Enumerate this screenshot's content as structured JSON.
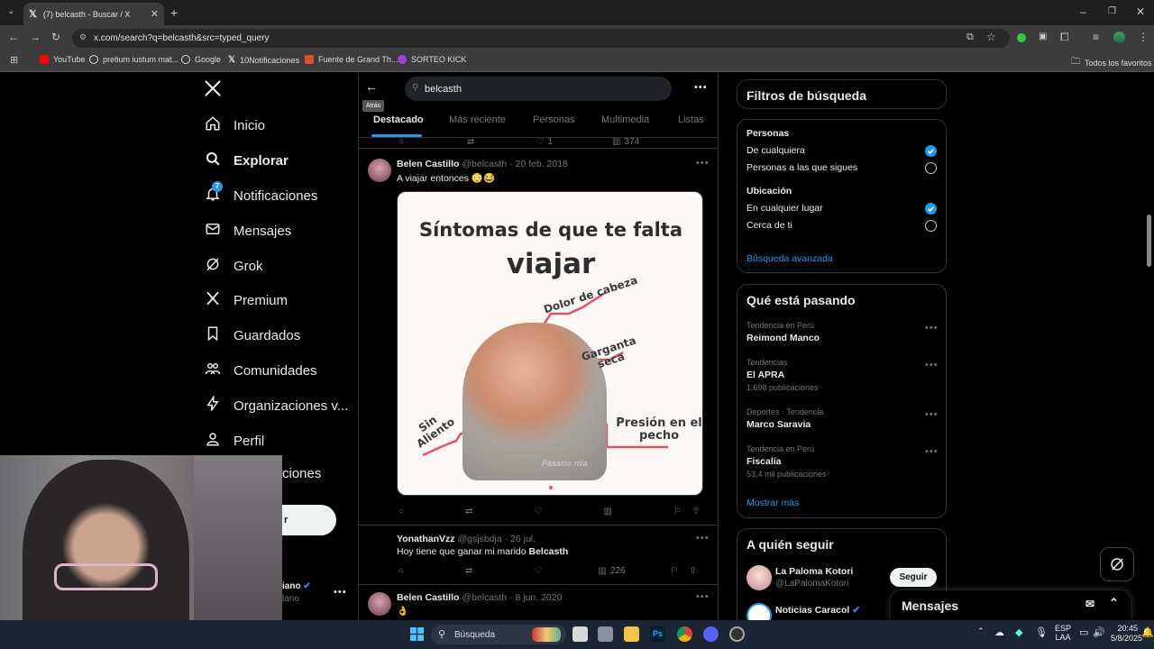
{
  "browser": {
    "tab_title": "(7) belcasth - Buscar / X",
    "url": "x.com/search?q=belcasth&src=typed_query",
    "bookmarks": [
      {
        "label": "YouTube",
        "color": "#ff0000"
      },
      {
        "label": "pretium iustum mat...",
        "color": "#dddddd"
      },
      {
        "label": "Google",
        "color": "#dddddd"
      },
      {
        "label": "10Notificaciones",
        "color": "#ffffff"
      },
      {
        "label": "Fuente de Grand Th...",
        "color": "#e34b2d"
      },
      {
        "label": "SORTEO KICK",
        "color": "#a03fd6"
      }
    ],
    "all_bookmarks": "Todos los favoritos"
  },
  "nav": {
    "items": [
      {
        "label": "Inicio",
        "icon": "home-icon"
      },
      {
        "label": "Explorar",
        "icon": "search-icon",
        "bold": true
      },
      {
        "label": "Notificaciones",
        "icon": "bell-icon",
        "badge": "7"
      },
      {
        "label": "Mensajes",
        "icon": "mail-icon"
      },
      {
        "label": "Grok",
        "icon": "grok-icon"
      },
      {
        "label": "Premium",
        "icon": "x-logo-icon"
      },
      {
        "label": "Guardados",
        "icon": "bookmark-icon"
      },
      {
        "label": "Comunidades",
        "icon": "communities-icon"
      },
      {
        "label": "Organizaciones v...",
        "icon": "lightning-icon"
      },
      {
        "label": "Perfil",
        "icon": "person-icon"
      },
      {
        "label": "ciones",
        "icon": ""
      }
    ],
    "post_btn": "r",
    "account_partial": "iano",
    "account_partial2": "lano"
  },
  "search": {
    "query": "belcasth",
    "tooltip": "Atrás",
    "tabs": [
      "Destacado",
      "Más reciente",
      "Personas",
      "Multimedia",
      "Listas"
    ]
  },
  "posts": [
    {
      "name": "Belen Castillo",
      "handle": "@belcasth",
      "date": "20 feb. 2018",
      "text": "A viajar entonces 😳😂",
      "meme": {
        "title1": "Síntomas de que te falta",
        "title2": "viajar",
        "labels": [
          "Dolor de cabeza",
          "Garganta seca",
          "Sin Aliento",
          "Presión en el pecho"
        ],
        "watermark": "Pasamo rola"
      }
    },
    {
      "name": "YonathanVzz",
      "handle": "@gsjsbdja",
      "date": "26 jul.",
      "text_pre": "Hoy tiene que ganar mi marido ",
      "text_bold": "Belcasth",
      "views": "226"
    },
    {
      "name": "Belen Castillo",
      "handle": "@belcasth",
      "date": "8 jun. 2020",
      "text": "👌"
    }
  ],
  "prev_post_stats": {
    "like": "1",
    "views": "374"
  },
  "filters": {
    "title": "Filtros de búsqueda",
    "people_h": "Personas",
    "people": [
      {
        "label": "De cualquiera",
        "on": true
      },
      {
        "label": "Personas a las que sigues",
        "on": false
      }
    ],
    "loc_h": "Ubicación",
    "loc": [
      {
        "label": "En cualquier lugar",
        "on": true
      },
      {
        "label": "Cerca de ti",
        "on": false
      }
    ],
    "advanced": "Búsqueda avanzada"
  },
  "trends": {
    "title": "Qué está pasando",
    "items": [
      {
        "sub": "Tendencia en Perú",
        "main": "Reimond Manco",
        "count": ""
      },
      {
        "sub": "Tendencias",
        "main": "El APRA",
        "count": "1.698 publicaciones"
      },
      {
        "sub": "Deportes · Tendencia",
        "main": "Marco Saravia",
        "count": ""
      },
      {
        "sub": "Tendencia en Perú",
        "main": "Fiscalía",
        "count": "53,4 mil publicaciones"
      }
    ],
    "more": "Mostrar más"
  },
  "who": {
    "title": "A quién seguir",
    "items": [
      {
        "name": "La Paloma Kotori",
        "handle": "@LaPalomaKotori",
        "btn": "Seguir"
      },
      {
        "name": "Noticias Caracol",
        "handle": ""
      }
    ]
  },
  "dm": {
    "title": "Mensajes"
  },
  "taskbar": {
    "search": "Búsqueda",
    "lang1": "ESP",
    "lang2": "LAA",
    "time": "20:45",
    "date": "5/8/2025"
  }
}
